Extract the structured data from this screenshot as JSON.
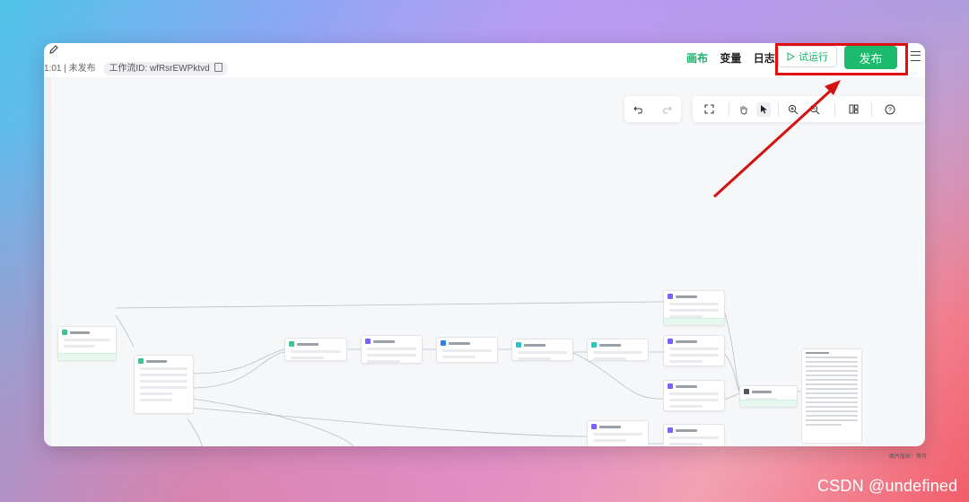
{
  "header": {
    "meta_prefix": "1:01 | 未发布",
    "workflow_id": "工作流ID: wfRsrEWPktvd"
  },
  "tabs": {
    "canvas": "画布",
    "variables": "变量",
    "logs": "日志"
  },
  "actions": {
    "trial_run": "试运行",
    "publish": "发布"
  },
  "toolbar": {
    "icons": [
      "undo-icon",
      "redo-icon",
      "fullscreen-icon",
      "hand-icon",
      "pointer-icon",
      "zoom-in-icon",
      "zoom-out-icon",
      "layout-icon",
      "help-icon"
    ]
  },
  "footer": {
    "image_credit": "图片版权：等可",
    "watermark": "CSDN @undefined"
  },
  "colors": {
    "accent": "#1bba6c",
    "highlight": "#e01010"
  }
}
